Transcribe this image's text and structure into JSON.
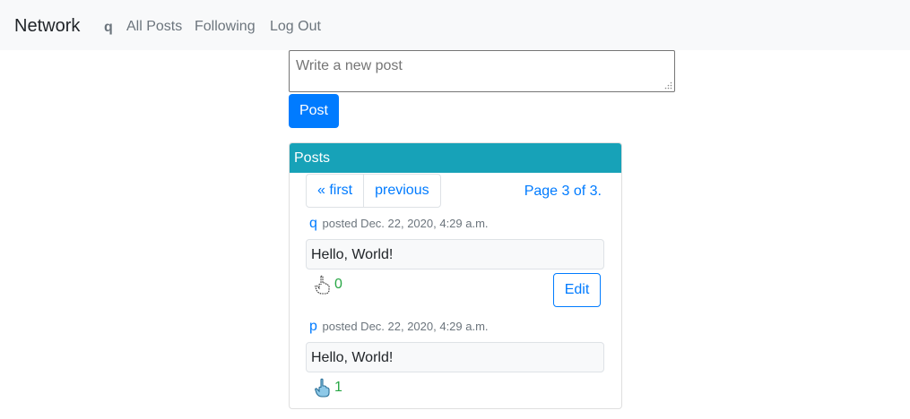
{
  "nav": {
    "brand": "Network",
    "user": "q",
    "links": [
      "All Posts",
      "Following",
      "Log Out"
    ]
  },
  "compose": {
    "placeholder": "Write a new post",
    "submit_label": "Post"
  },
  "posts_card": {
    "header": "Posts",
    "pagination": {
      "first": "« first",
      "previous": "previous",
      "status": "Page 3 of 3."
    },
    "posts": [
      {
        "author": "q",
        "meta": "posted Dec. 22, 2020, 4:29 a.m.",
        "content": "Hello, World!",
        "like_icon": "hand-pointing-outline-icon",
        "likes": "0",
        "edit_label": "Edit"
      },
      {
        "author": "p",
        "meta": "posted Dec. 22, 2020, 4:29 a.m.",
        "content": "Hello, World!",
        "like_icon": "hand-pointing-filled-icon",
        "likes": "1"
      }
    ]
  },
  "colors": {
    "primary": "#007bff",
    "header": "#17a2b8",
    "likes": "#28a745",
    "navbar": "#f8f9fa"
  }
}
